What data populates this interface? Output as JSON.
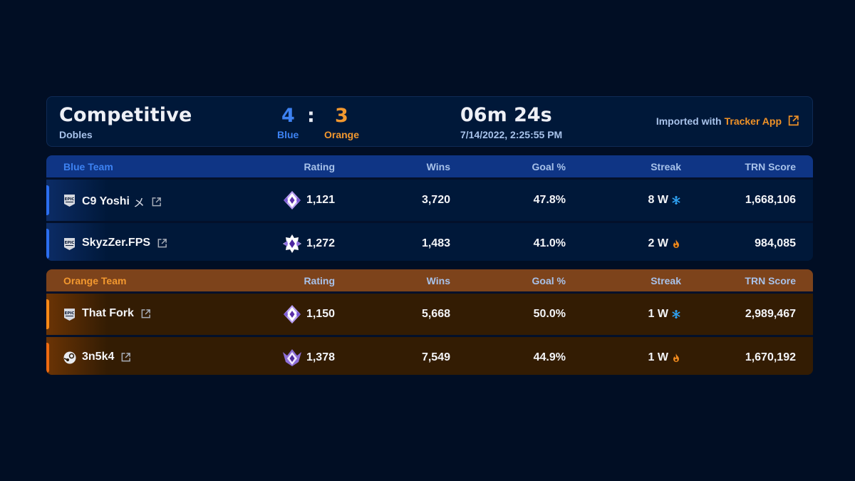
{
  "header": {
    "mode_title": "Competitive",
    "mode_subtitle": "Dobles",
    "score": {
      "blue": "4",
      "separator": ":",
      "orange": "3",
      "blue_label": "Blue",
      "orange_label": "Orange"
    },
    "duration": "06m 24s",
    "datetime": "7/14/2022, 2:25:55 PM",
    "imported_prefix": "Imported with",
    "imported_link": "Tracker App",
    "imported_icon": "external-link-icon"
  },
  "columns": {
    "rating": "Rating",
    "wins": "Wins",
    "goal_pct": "Goal %",
    "streak": "Streak",
    "trn_score": "TRN Score"
  },
  "colors": {
    "blue_accent": "#3d82f2",
    "orange_accent": "#f2982f",
    "background": "#010e24",
    "link": "#f09227"
  },
  "teams": [
    {
      "name": "Blue Team",
      "players": [
        {
          "platform_icon": "epic-games-icon",
          "name": "C9 Yoshi",
          "name_suffix": "メ",
          "rank_icon": "champion-rank-icon",
          "rating": "1,121",
          "wins": "3,720",
          "goal_pct": "47.8%",
          "streak": "8 W",
          "streak_icon": "snowflake-icon",
          "trn_score": "1,668,106"
        },
        {
          "platform_icon": "epic-games-icon",
          "name": "SkyzZer.FPS",
          "name_suffix": "",
          "rank_icon": "champion-rank-icon",
          "rating": "1,272",
          "wins": "1,483",
          "goal_pct": "41.0%",
          "streak": "2 W",
          "streak_icon": "flame-icon",
          "trn_score": "984,085"
        }
      ]
    },
    {
      "name": "Orange Team",
      "players": [
        {
          "platform_icon": "epic-games-icon",
          "name": "That Fork",
          "name_suffix": "",
          "rank_icon": "champion-rank-icon",
          "rating": "1,150",
          "wins": "5,668",
          "goal_pct": "50.0%",
          "streak": "1 W",
          "streak_icon": "snowflake-icon",
          "trn_score": "2,989,467"
        },
        {
          "platform_icon": "steam-icon",
          "name": "3n5k4",
          "name_suffix": "",
          "rank_icon": "grand-champion-rank-icon",
          "rating": "1,378",
          "wins": "7,549",
          "goal_pct": "44.9%",
          "streak": "1 W",
          "streak_icon": "flame-icon",
          "trn_score": "1,670,192"
        }
      ]
    }
  ]
}
